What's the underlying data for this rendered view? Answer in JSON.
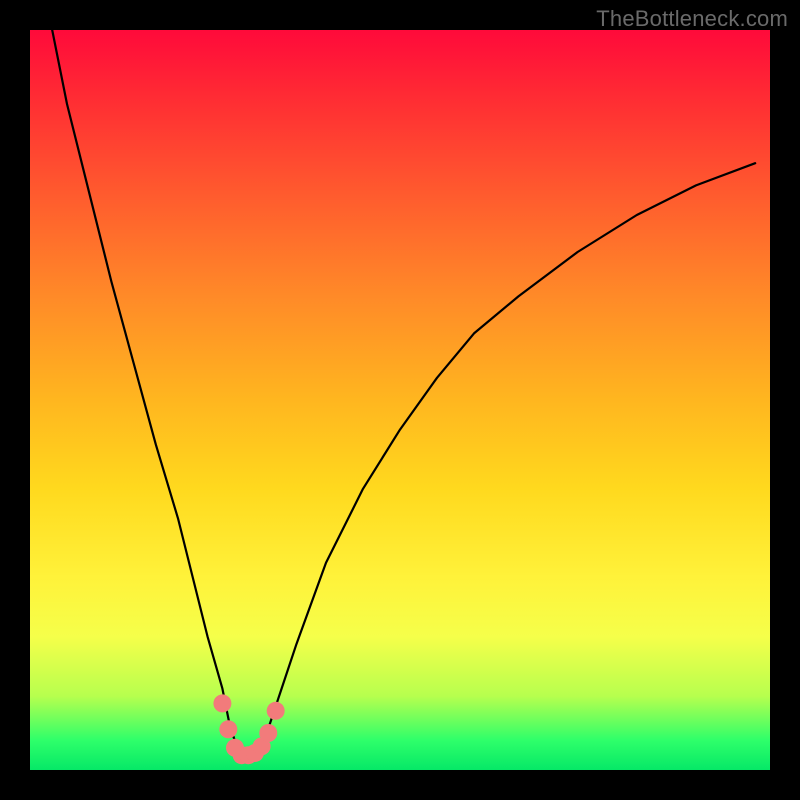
{
  "watermark": "TheBottleneck.com",
  "chart_data": {
    "type": "line",
    "title": "",
    "xlabel": "",
    "ylabel": "",
    "xlim": [
      0,
      100
    ],
    "ylim": [
      0,
      100
    ],
    "series": [
      {
        "name": "bottleneck-curve",
        "x": [
          3,
          5,
          8,
          11,
          14,
          17,
          20,
          22,
          24,
          26,
          27,
          28,
          28.5,
          29,
          30,
          31,
          32,
          33,
          34,
          36,
          40,
          45,
          50,
          55,
          60,
          66,
          74,
          82,
          90,
          98
        ],
        "values": [
          100,
          90,
          78,
          66,
          55,
          44,
          34,
          26,
          18,
          11,
          6,
          3,
          2,
          2,
          2,
          3,
          5,
          8,
          11,
          17,
          28,
          38,
          46,
          53,
          59,
          64,
          70,
          75,
          79,
          82
        ]
      }
    ],
    "markers": {
      "name": "highlight-dots",
      "color": "#f27b7b",
      "x": [
        26.0,
        26.8,
        27.7,
        28.6,
        29.5,
        30.4,
        31.3,
        32.2,
        33.2
      ],
      "values": [
        9.0,
        5.5,
        3.0,
        2.0,
        2.0,
        2.3,
        3.2,
        5.0,
        8.0
      ]
    },
    "gradient_stops": [
      {
        "pos": 0,
        "color": "#ff0a3a"
      },
      {
        "pos": 10,
        "color": "#ff2f33"
      },
      {
        "pos": 22,
        "color": "#ff5a2e"
      },
      {
        "pos": 36,
        "color": "#ff8a28"
      },
      {
        "pos": 50,
        "color": "#ffb61f"
      },
      {
        "pos": 62,
        "color": "#ffd91e"
      },
      {
        "pos": 74,
        "color": "#fff23a"
      },
      {
        "pos": 82,
        "color": "#f5ff4a"
      },
      {
        "pos": 90,
        "color": "#b7ff4e"
      },
      {
        "pos": 96,
        "color": "#2eff6a"
      },
      {
        "pos": 100,
        "color": "#06e867"
      }
    ]
  }
}
